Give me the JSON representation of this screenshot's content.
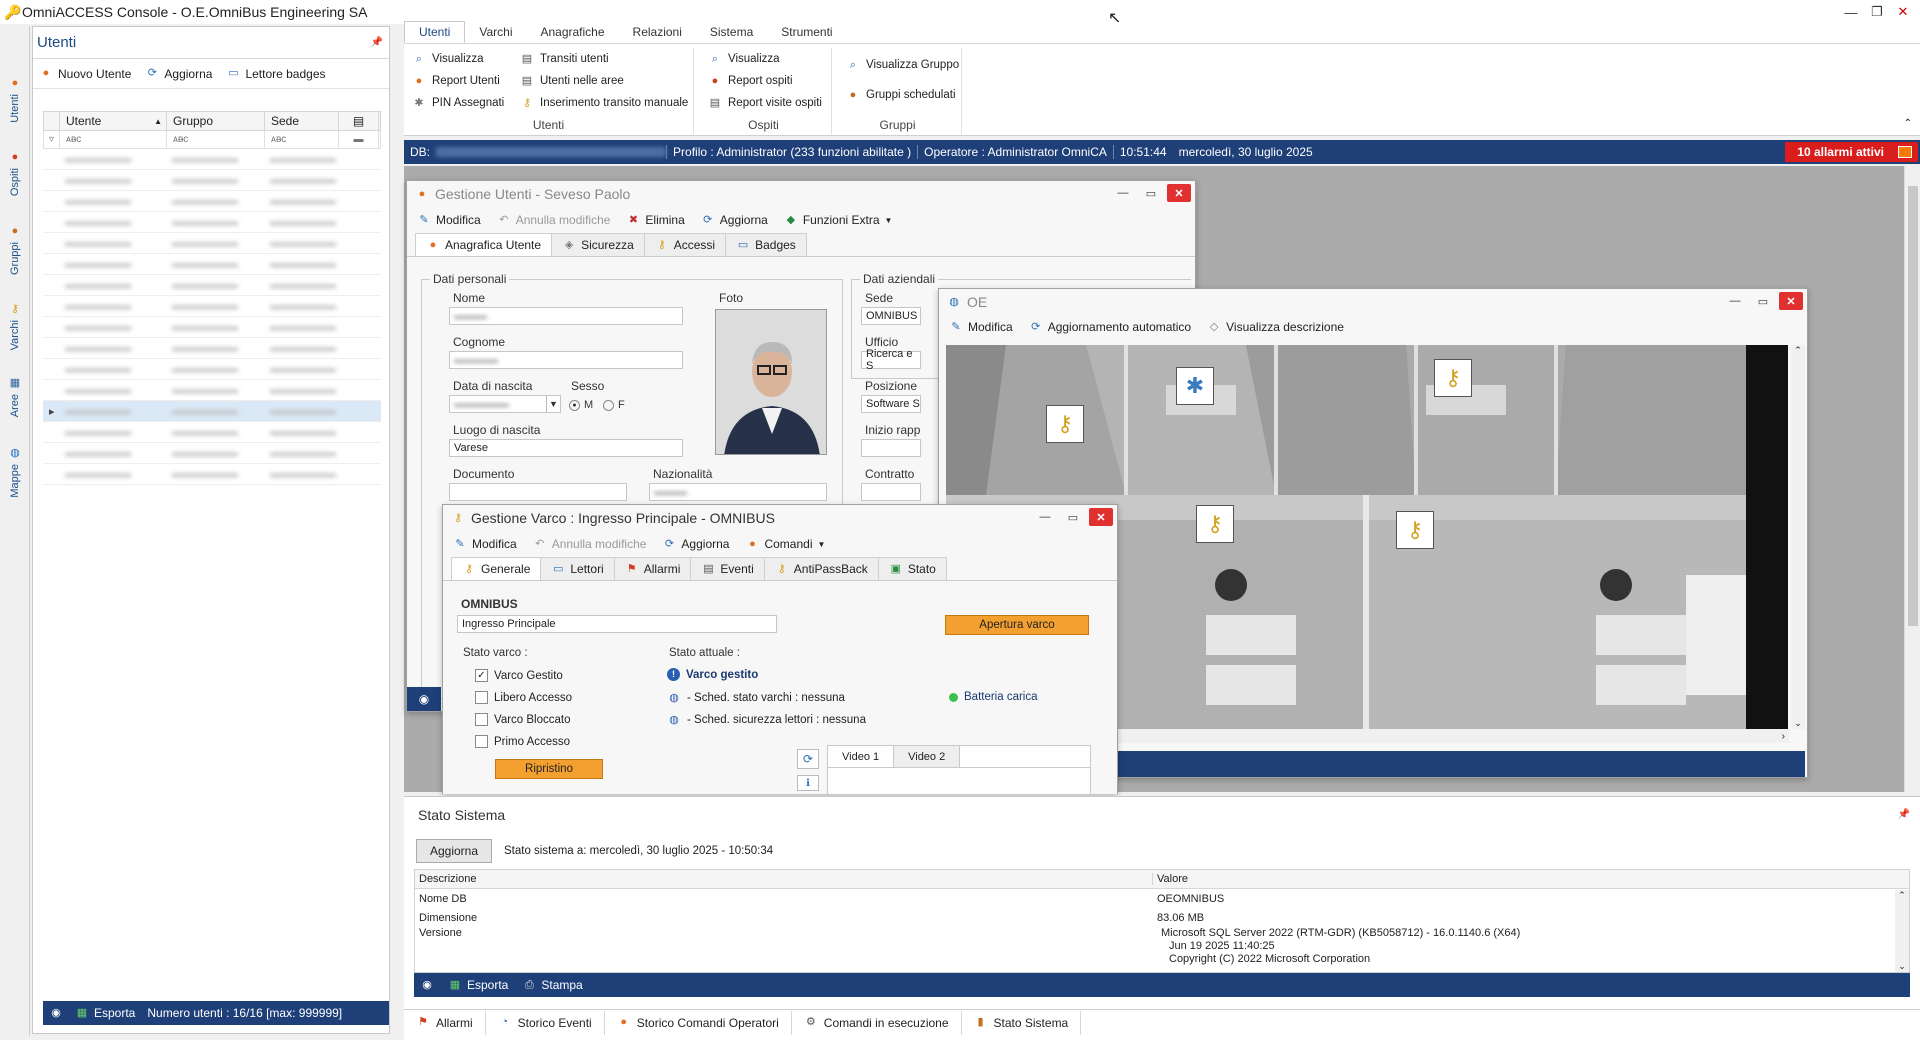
{
  "window": {
    "title": "OmniACCESS Console - O.E.OmniBus Engineering SA"
  },
  "rail": [
    {
      "label": "Utenti"
    },
    {
      "label": "Ospiti"
    },
    {
      "label": "Gruppi"
    },
    {
      "label": "Varchi"
    },
    {
      "label": "Aree"
    },
    {
      "label": "Mappe"
    }
  ],
  "left": {
    "title": "Utenti",
    "tools": {
      "new": "Nuovo Utente",
      "refresh": "Aggiorna",
      "badges": "Lettore badges"
    },
    "columns": {
      "user": "Utente",
      "group": "Gruppo",
      "site": "Sede"
    },
    "footer": {
      "export": "Esporta",
      "count": "Numero utenti : 16/16 [max: 999999]"
    }
  },
  "ribbon": {
    "tabs": [
      "Utenti",
      "Varchi",
      "Anagrafiche",
      "Relazioni",
      "Sistema",
      "Strumenti"
    ],
    "groups": {
      "utenti": {
        "title": "Utenti",
        "items": [
          "Visualizza",
          "Report Utenti",
          "PIN Assegnati",
          "Transiti utenti",
          "Utenti nelle aree",
          "Inserimento transito manuale"
        ]
      },
      "ospiti": {
        "title": "Ospiti",
        "items": [
          "Visualizza",
          "Report ospiti",
          "Report visite ospiti"
        ]
      },
      "gruppi": {
        "title": "Gruppi",
        "items": [
          "Visualizza Gruppo",
          "Gruppi schedulati"
        ]
      }
    }
  },
  "status": {
    "db": "DB:",
    "profile": "Profilo : Administrator (233  funzioni abilitate )",
    "operator": "Operatore : Administrator OmniCA",
    "time": "10:51:44",
    "date": "mercoledì, 30 luglio 2025",
    "alarms": "10  allarmi attivi"
  },
  "gestione_utenti": {
    "title": "Gestione Utenti  - Seveso Paolo",
    "toolbar": {
      "edit": "Modifica",
      "cancel": "Annulla modifiche",
      "delete": "Elimina",
      "refresh": "Aggiorna",
      "extra": "Funzioni Extra"
    },
    "tabs": [
      "Anagrafica Utente",
      "Sicurezza",
      "Accessi",
      "Badges"
    ],
    "personal": {
      "group_label": "Dati personali",
      "name_label": "Nome",
      "surname_label": "Cognome",
      "birth_label": "Data di nascita",
      "sex_label": "Sesso",
      "sex_m": "M",
      "sex_f": "F",
      "birthplace_label": "Luogo di nascita",
      "birthplace": "Varese",
      "doc_label": "Documento",
      "nationality_label": "Nazionalità",
      "photo_label": "Foto"
    },
    "company": {
      "group_label": "Dati aziendali",
      "site_label": "Sede",
      "site": "OMNIBUS",
      "office_label": "Ufficio",
      "office": "Ricerca e S",
      "position_label": "Posizione",
      "position": "Software S",
      "start_label": "Inizio rapp",
      "contract_label": "Contratto"
    }
  },
  "oe": {
    "title": "OE",
    "toolbar": {
      "edit": "Modifica",
      "auto": "Aggiornamento automatico",
      "desc": "Visualizza descrizione"
    }
  },
  "varco": {
    "title": "Gestione Varco : Ingresso Principale - OMNIBUS",
    "toolbar": {
      "edit": "Modifica",
      "cancel": "Annulla modifiche",
      "refresh": "Aggiorna",
      "commands": "Comandi"
    },
    "tabs": [
      "Generale",
      "Lettori",
      "Allarmi",
      "Eventi",
      "AntiPassBack",
      "Stato"
    ],
    "site": "OMNIBUS",
    "name": "Ingresso Principale",
    "open_btn": "Apertura varco",
    "stato_varco_label": "Stato varco :",
    "checks": [
      {
        "label": "Varco Gestito",
        "checked": true
      },
      {
        "label": "Libero Accesso",
        "checked": false
      },
      {
        "label": "Varco Bloccato",
        "checked": false
      },
      {
        "label": "Primo Accesso",
        "checked": false
      }
    ],
    "restore_btn": "Ripristino",
    "stato_attuale_label": "Stato attuale :",
    "managed": "Varco gestito",
    "sched1": "- Sched. stato varchi :  nessuna",
    "sched2": "- Sched. sicurezza lettori :  nessuna",
    "battery": "Batteria carica",
    "video_tabs": [
      "Video 1",
      "Video 2"
    ]
  },
  "sistema": {
    "title": "Stato Sistema",
    "refresh": "Aggiorna",
    "stamp": "Stato sistema a:  mercoledì, 30 luglio 2025 - 10:50:34",
    "columns": {
      "desc": "Descrizione",
      "value": "Valore"
    },
    "rows": [
      {
        "desc": "Nome DB",
        "value": "OEOMNIBUS"
      },
      {
        "desc": "Dimensione",
        "value": "83.06 MB"
      },
      {
        "desc": "Versione",
        "value": "Microsoft SQL Server 2022 (RTM-GDR) (KB5058712) - 16.0.1140.6 (X64)"
      }
    ],
    "version_lines": [
      "Jun 19 2025 11:40:25",
      "Copyright (C) 2022 Microsoft Corporation"
    ],
    "footer": {
      "export": "Esporta",
      "print": "Stampa"
    }
  },
  "bottom_tabs": [
    "Allarmi",
    "Storico Eventi",
    "Storico Comandi Operatori",
    "Comandi in esecuzione",
    "Stato Sistema"
  ]
}
